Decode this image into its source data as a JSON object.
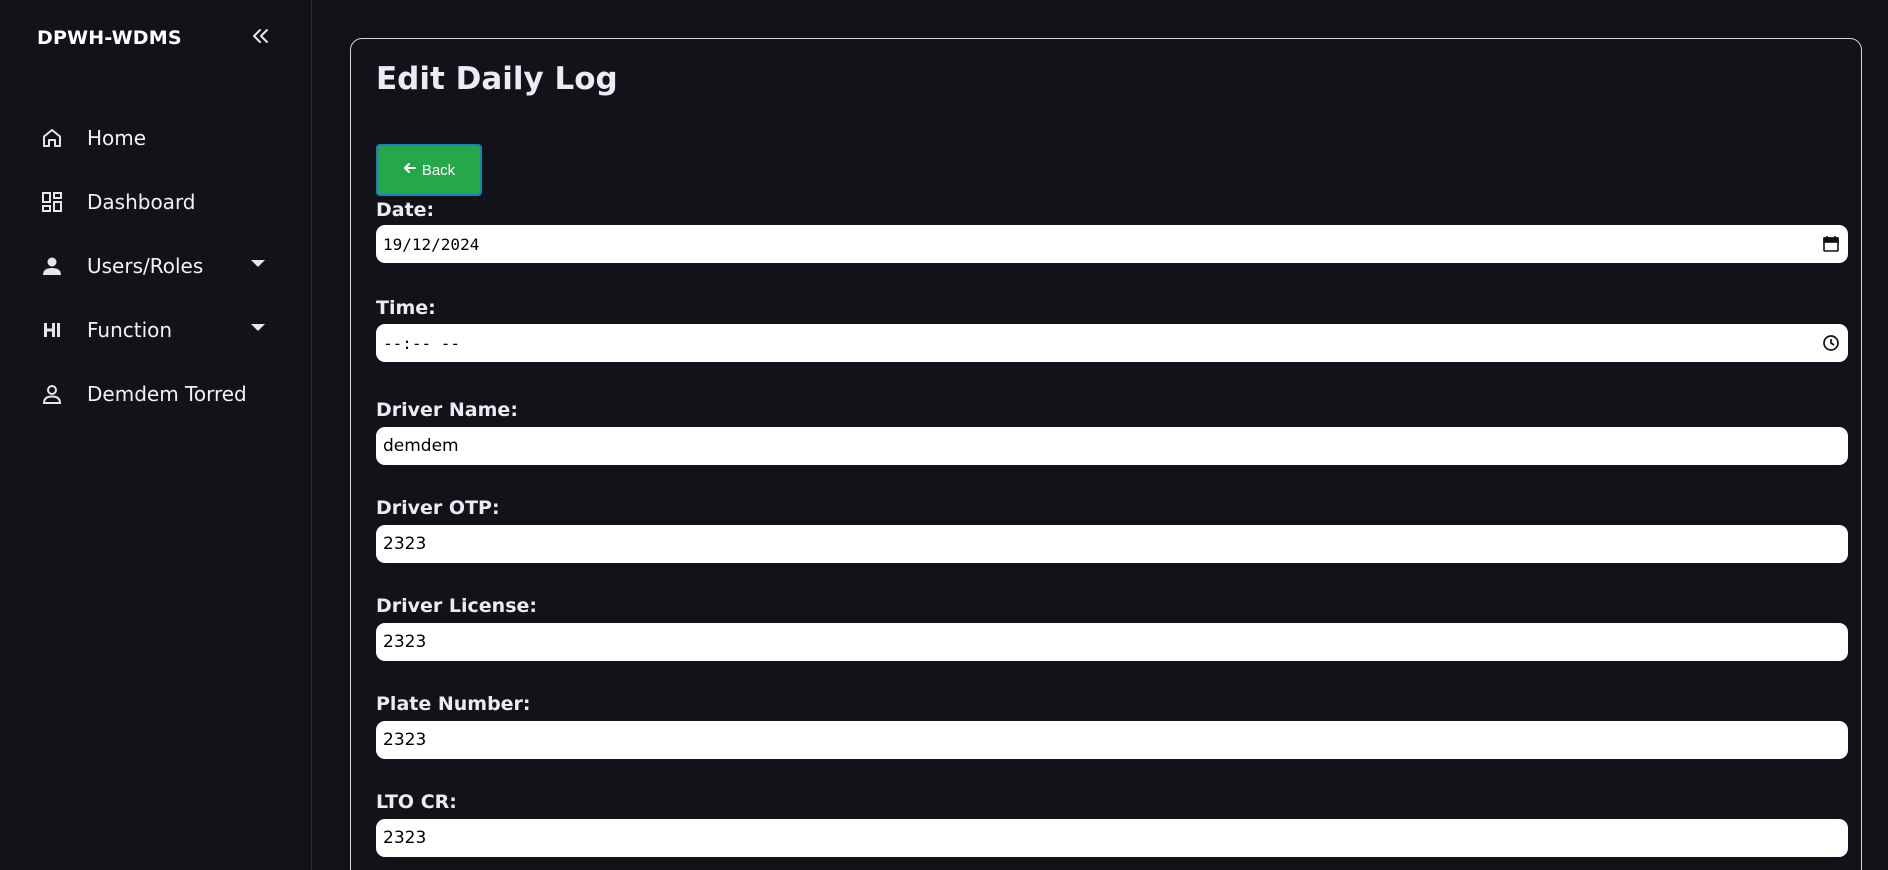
{
  "sidebar": {
    "brand": "DPWH-WDMS",
    "collapse_icon": "double-chevron-left-icon",
    "items": [
      {
        "label": "Home",
        "icon": "home-icon"
      },
      {
        "label": "Dashboard",
        "icon": "dashboard-icon"
      },
      {
        "label": "Users/Roles",
        "icon": "user-icon",
        "has_dropdown": true
      },
      {
        "label": "Function",
        "icon": "function-icon",
        "has_dropdown": true
      },
      {
        "label": "Demdem Torred",
        "icon": "profile-icon"
      }
    ]
  },
  "main": {
    "title": "Edit Daily Log",
    "back_label": "Back",
    "fields": [
      {
        "label": "Date:",
        "value": "19/12/2024",
        "trail_icon": "calendar-icon"
      },
      {
        "label": "Time:",
        "value": "--:-- --",
        "trail_icon": "clock-icon"
      },
      {
        "label": "Driver Name:",
        "value": "demdem"
      },
      {
        "label": "Driver OTP:",
        "value": "2323"
      },
      {
        "label": "Driver License:",
        "value": "2323"
      },
      {
        "label": "Plate Number:",
        "value": "2323"
      },
      {
        "label": "LTO CR:",
        "value": "2323"
      }
    ]
  },
  "colors": {
    "background": "#121319",
    "back_button": "#25a84a",
    "input_background": "#ffffff"
  }
}
